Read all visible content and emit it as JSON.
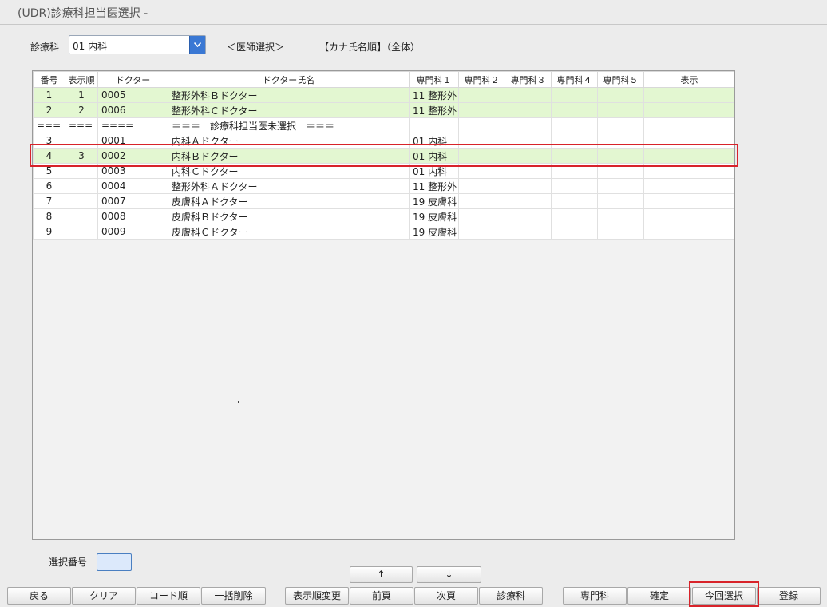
{
  "window": {
    "title": "(UDR)診療科担当医選択 -"
  },
  "department": {
    "label": "診療科",
    "value": "01 内科"
  },
  "mode_label": "＜医師選択＞",
  "sort_label": "【カナ氏名順】（全体）",
  "table": {
    "headers": [
      "番号",
      "表示順",
      "ドクター",
      "ドクター氏名",
      "専門科１",
      "専門科２",
      "専門科３",
      "専門科４",
      "専門科５",
      "表示"
    ],
    "rows": [
      [
        "1",
        "1",
        "0005",
        "整形外科Ｂドクター",
        "11 整形外",
        "",
        "",
        "",
        "",
        ""
      ],
      [
        "2",
        "2",
        "0006",
        "整形外科Ｃドクター",
        "11 整形外",
        "",
        "",
        "",
        "",
        ""
      ],
      [
        "===",
        "===",
        "====",
        "＝＝＝　診療科担当医未選択　＝＝＝",
        "",
        "",
        "",
        "",
        "",
        ""
      ],
      [
        "3",
        "",
        "0001",
        "内科Ａドクター",
        "01 内科",
        "",
        "",
        "",
        "",
        ""
      ],
      [
        "4",
        "3",
        "0002",
        "内科Ｂドクター",
        "01 内科",
        "",
        "",
        "",
        "",
        ""
      ],
      [
        "5",
        "",
        "0003",
        "内科Ｃドクター",
        "01 内科",
        "",
        "",
        "",
        "",
        ""
      ],
      [
        "6",
        "",
        "0004",
        "整形外科Ａドクター",
        "11 整形外",
        "",
        "",
        "",
        "",
        ""
      ],
      [
        "7",
        "",
        "0007",
        "皮膚科Ａドクター",
        "19 皮膚科",
        "",
        "",
        "",
        "",
        ""
      ],
      [
        "8",
        "",
        "0008",
        "皮膚科Ｂドクター",
        "19 皮膚科",
        "",
        "",
        "",
        "",
        ""
      ],
      [
        "9",
        "",
        "0009",
        "皮膚科Ｃドクター",
        "19 皮膚科",
        "",
        "",
        "",
        "",
        ""
      ]
    ]
  },
  "select_number": {
    "label": "選択番号",
    "value": ""
  },
  "buttons": {
    "back": "戻る",
    "clear": "クリア",
    "code_order": "コード順",
    "bulk_delete": "一括削除",
    "display_order_change": "表示順変更",
    "prev_page": "前頁",
    "next_page": "次頁",
    "department": "診療科",
    "specialty": "専門科",
    "confirm": "確定",
    "current_selection": "今回選択",
    "register": "登録",
    "up": "↑",
    "down": "↓"
  },
  "colors": {
    "highlight_row": "#e3f7d1",
    "red_outline": "#d8232a",
    "dropdown_button": "#3a78d4"
  }
}
